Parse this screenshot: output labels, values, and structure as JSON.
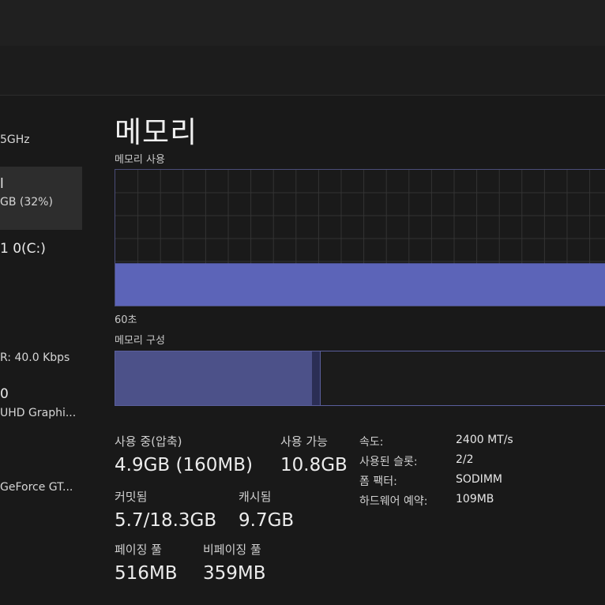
{
  "colors": {
    "accent": "#5c64b8",
    "background": "#191919",
    "grid": "#333333"
  },
  "sidebar": {
    "items": [
      {
        "line1": "5GHz"
      },
      {
        "line1": "l",
        "line2": "GB (32%)",
        "selected": true
      },
      {
        "line1": "1 0(C:)"
      },
      {
        "line1": "R: 40.0 Kbps"
      },
      {
        "line1": "0",
        "line2": "UHD Graphi..."
      },
      {
        "line1": "GeForce GT..."
      }
    ]
  },
  "main": {
    "title": "메모리",
    "usage_label": "메모리 사용",
    "time_label": "60초",
    "composition_label": "메모리 구성",
    "usage_fraction": 0.32,
    "composition": {
      "in_use_fraction": 0.395,
      "modified_fraction": 0.016
    }
  },
  "stats": {
    "in_use_label": "사용 중(압축)",
    "in_use_value": "4.9GB (160MB)",
    "available_label": "사용 가능",
    "available_value": "10.8GB",
    "committed_label": "커밋됨",
    "committed_value": "5.7/18.3GB",
    "cached_label": "캐시됨",
    "cached_value": "9.7GB",
    "paged_label": "페이징 풀",
    "paged_value": "516MB",
    "nonpaged_label": "비페이징 풀",
    "nonpaged_value": "359MB"
  },
  "info": {
    "speed_label": "속도:",
    "speed_value": "2400 MT/s",
    "slots_label": "사용된 슬롯:",
    "slots_value": "2/2",
    "form_label": "폼 팩터:",
    "form_value": "SODIMM",
    "reserved_label": "하드웨어 예약:",
    "reserved_value": "109MB"
  }
}
